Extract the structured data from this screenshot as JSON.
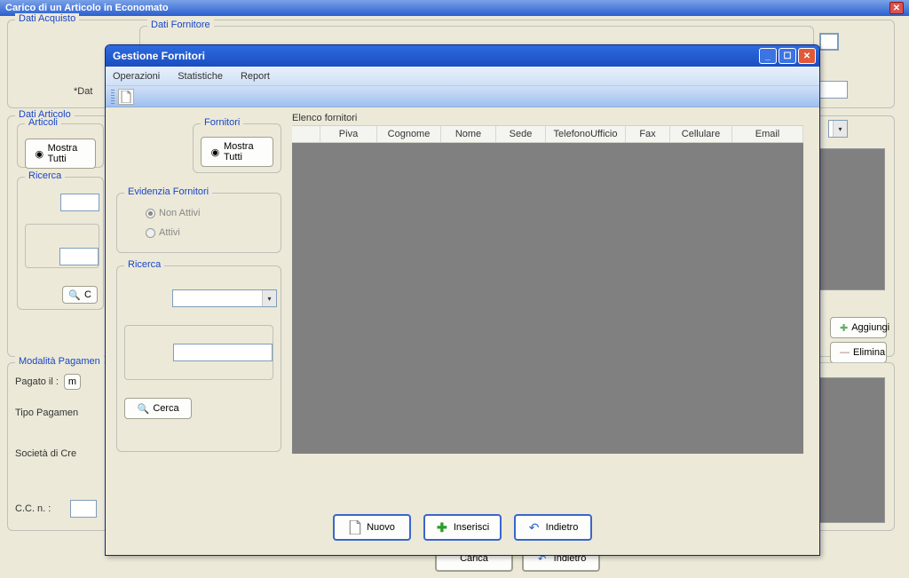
{
  "outerWindow": {
    "title": "Carico di un Articolo in Economato"
  },
  "background": {
    "datiAcquisto": "Dati Acquisto",
    "datiFornitore": "Dati Fornitore",
    "datLabel": "*Dat",
    "datiArticolo": "Dati Articolo",
    "articoli": "Articoli",
    "mostraTutti": "Mostra Tutti",
    "ricerca": "Ricerca",
    "c": "C",
    "modalitaPagamen": "Modalità Pagamen",
    "pagatoIl": "Pagato il  :",
    "m": "m",
    "tipoPagamen": "Tipo Pagamen",
    "societaCre": "Società di Cre",
    "ccn": "C.C. n. :",
    "aggiungi": "Aggiungi",
    "elimina": "Elimina",
    "carica": "Carica",
    "indietro": "Indietro",
    "euro": "€"
  },
  "dialog": {
    "title": "Gestione Fornitori",
    "menu": {
      "operazioni": "Operazioni",
      "statistiche": "Statistiche",
      "report": "Report"
    },
    "fornitori": "Fornitori",
    "mostraTutti": "Mostra Tutti",
    "evidenziaFornitori": "Evidenzia Fornitori",
    "nonAttivi": "Non Attivi",
    "attivi": "Attivi",
    "ricerca": "Ricerca",
    "cerca": "Cerca",
    "elencoFornitori": "Elenco fornitori",
    "columns": {
      "piva": "Piva",
      "cognome": "Cognome",
      "nome": "Nome",
      "sede": "Sede",
      "telefonoUfficio": "TelefonoUfficio",
      "fax": "Fax",
      "cellulare": "Cellulare",
      "email": "Email"
    },
    "buttons": {
      "nuovo": "Nuovo",
      "inserisci": "Inserisci",
      "indietro": "Indietro"
    }
  }
}
